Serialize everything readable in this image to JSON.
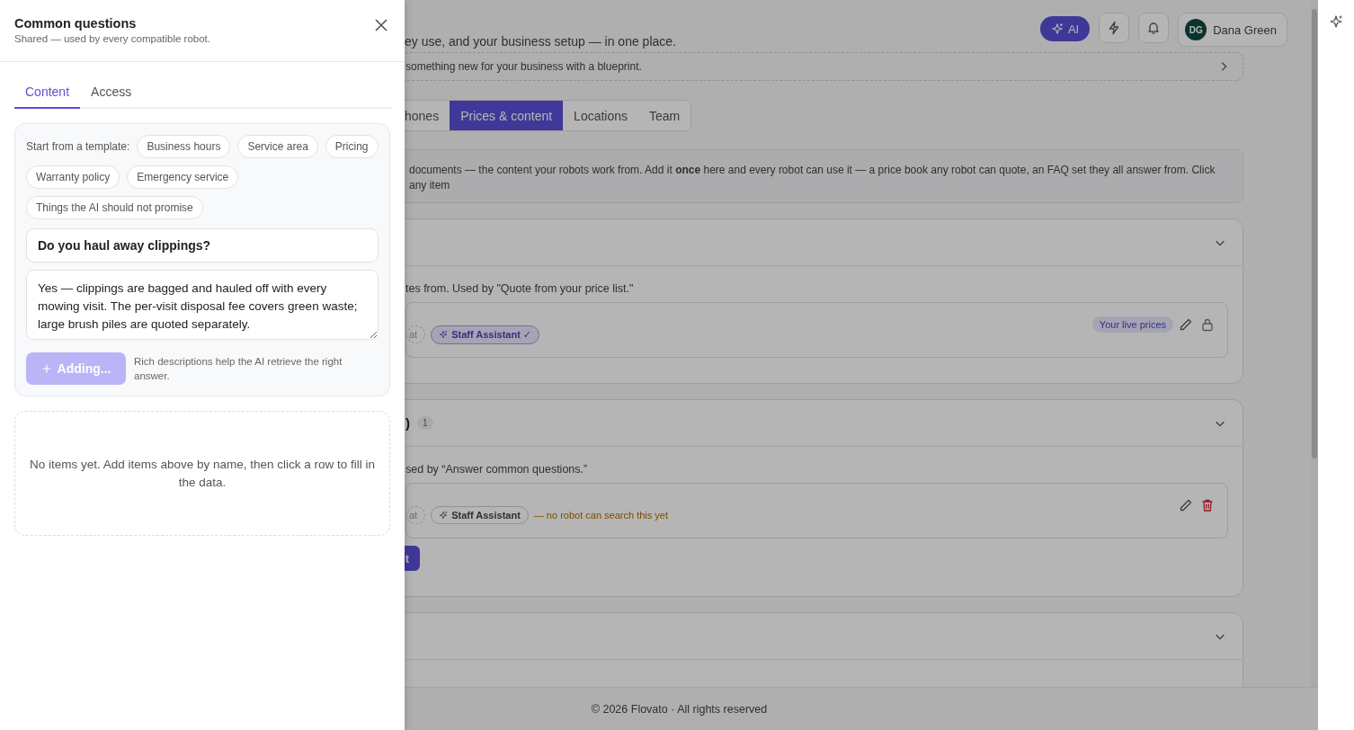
{
  "page": {
    "subtitle": "ey use, and your business setup — in one place.",
    "ai_button": "AI",
    "user": {
      "initials": "DG",
      "name": "Dana Green"
    },
    "blueprint_banner": "something new for your business with a blueprint.",
    "tabs": [
      {
        "label": "hones",
        "selected": false
      },
      {
        "label": "Prices & content",
        "selected": true
      },
      {
        "label": "Locations",
        "selected": false
      },
      {
        "label": "Team",
        "selected": false
      }
    ],
    "info_text": "documents — the content your robots work from. Add it **once** here and every robot can use it — a price book any robot can quote, an FAQ set they all answer from. Click any item",
    "sections": [
      {
        "expanded": true,
        "description": "tes from. Used by \"Quote from your price list.\"",
        "item": {
          "chips": [
            {
              "label": "at",
              "selected": false
            },
            {
              "label": "Staff Assistant ✓",
              "selected": true
            }
          ],
          "badge": "Your live prices",
          "actions": [
            {
              "kind": "edit"
            },
            {
              "kind": "lock"
            }
          ]
        }
      },
      {
        "expanded": true,
        "title": ")",
        "count": "1",
        "description": "sed by “Answer common questions.”",
        "item": {
          "chips": [
            {
              "label": "at",
              "selected": false
            },
            {
              "label": "Staff Assistant",
              "selected": false
            }
          ],
          "note": "— no robot can search this yet",
          "actions": [
            {
              "kind": "edit"
            },
            {
              "kind": "delete"
            }
          ]
        },
        "button": "t"
      },
      {
        "expanded": true
      }
    ],
    "footer": "© 2026 Flovato · All rights reserved"
  },
  "drawer": {
    "title": "Common questions",
    "subtitle": "Shared — used by every compatible robot.",
    "tabs": [
      {
        "label": "Content",
        "selected": true
      },
      {
        "label": "Access",
        "selected": false
      }
    ],
    "template_label": "Start from a template:",
    "templates": [
      "Business hours",
      "Service area",
      "Pricing",
      "Warranty policy",
      "Emergency service",
      "Things the AI should not promise"
    ],
    "question": {
      "value": "Do you haul away clippings?"
    },
    "answer": {
      "value": "Yes — clippings are bagged and hauled off with every mowing visit. The per-visit disposal fee covers green waste; large brush piles are quoted separately."
    },
    "add_button": {
      "label": "Adding...",
      "disabled": true
    },
    "hint": "Rich descriptions help the AI retrieve the right answer.",
    "empty_state": "No items yet. Add items above by name, then click a row to fill in the data."
  }
}
